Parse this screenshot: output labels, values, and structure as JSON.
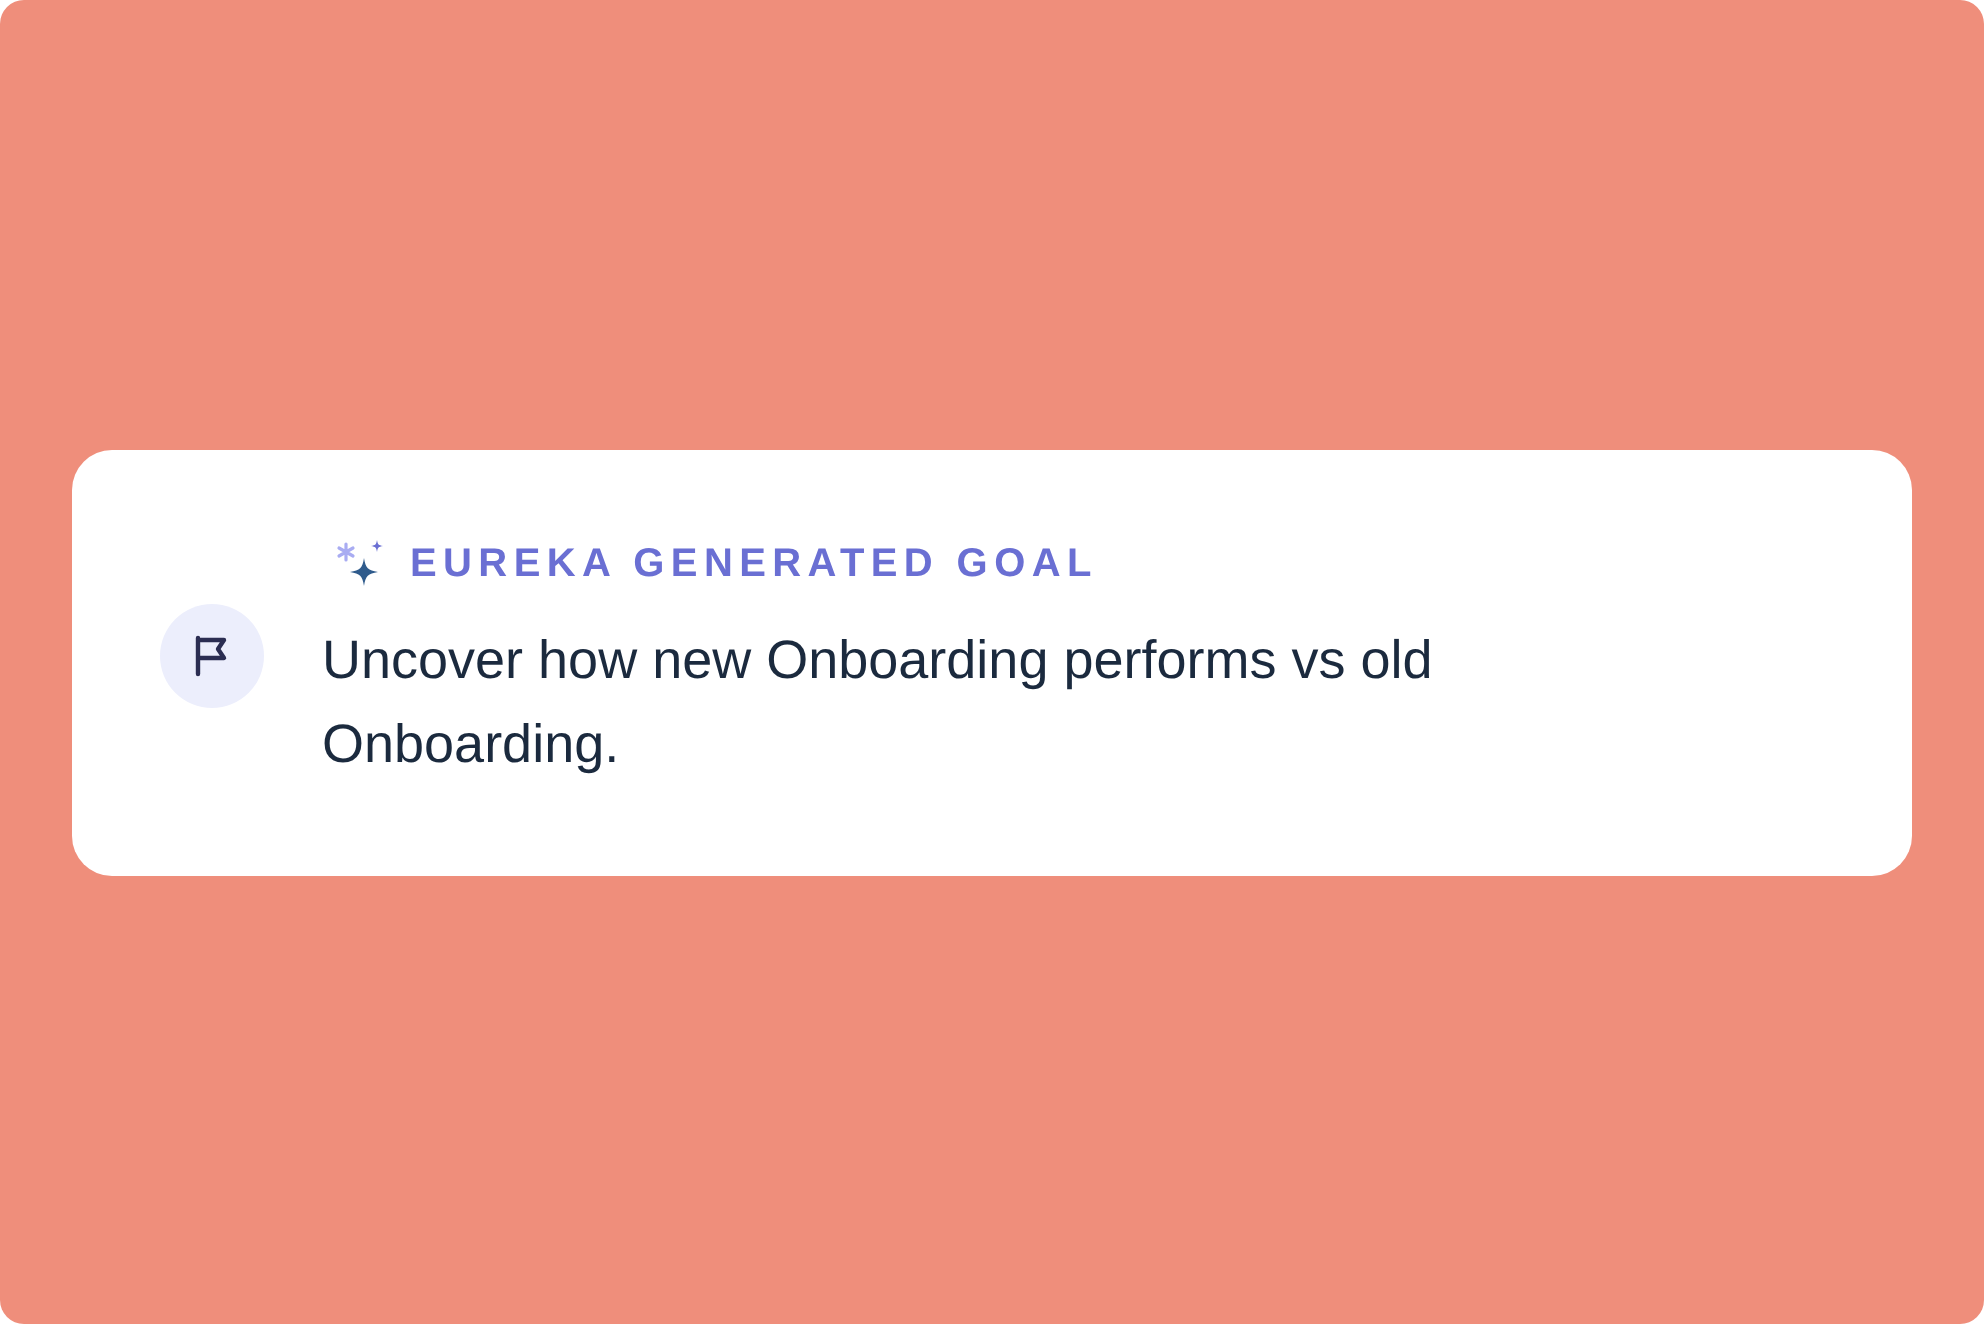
{
  "card": {
    "label": "EUREKA GENERATED GOAL",
    "goal": "Uncover how new Onboarding performs vs old Onboarding."
  }
}
